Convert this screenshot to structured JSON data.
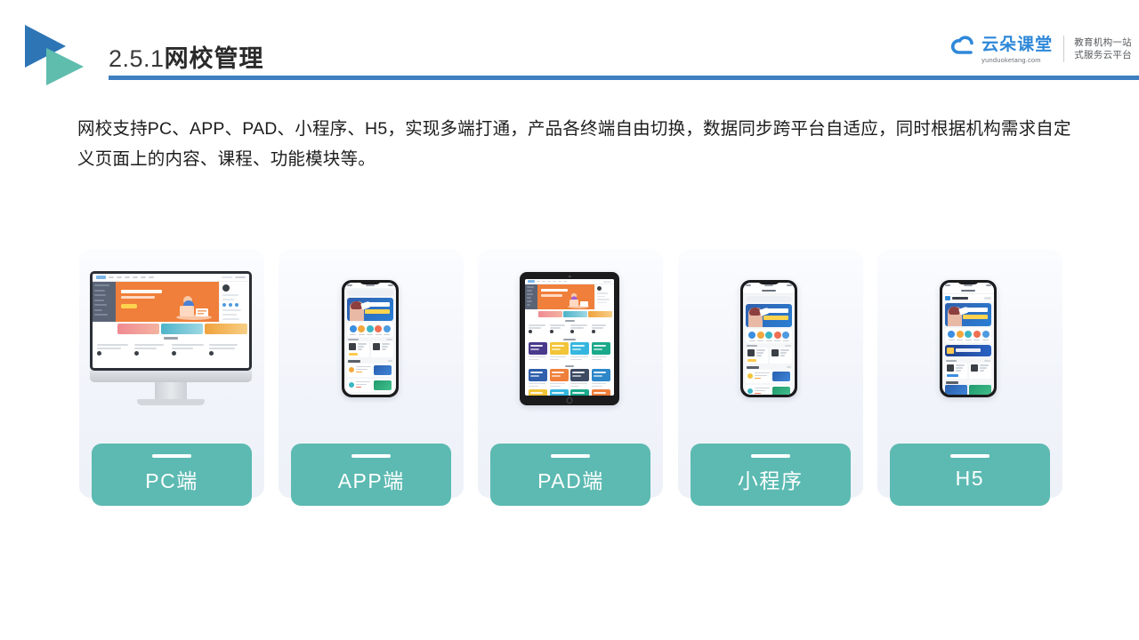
{
  "slide": {
    "header": {
      "title_number": "2.5.1",
      "title_text": "网校管理",
      "rule_color": "#3D7FC1",
      "logo_mark": {
        "blue_triangle_color": "#2E75B6",
        "teal_triangle_color": "#5FBDAE"
      }
    },
    "brand": {
      "name": "云朵课堂",
      "url": "yunduoketang.com",
      "tagline_line1": "教育机构一站",
      "tagline_line2": "式服务云平台",
      "brand_color": "#2E88D8"
    },
    "body_paragraph": "网校支持PC、APP、PAD、小程序、H5，实现多端打通，产品各终端自由切换，数据同步跨平台自适应，同时根据机构需求自定义页面上的内容、课程、功能模块等。",
    "accent_color": "#5CBAB2",
    "panel_background": "#F1F4FA",
    "cards": [
      {
        "label": "PC端",
        "device": "desktop-monitor"
      },
      {
        "label": "APP端",
        "device": "smartphone"
      },
      {
        "label": "PAD端",
        "device": "tablet"
      },
      {
        "label": "小程序",
        "device": "smartphone-miniprogram"
      },
      {
        "label": "H5",
        "device": "smartphone-h5"
      }
    ]
  }
}
